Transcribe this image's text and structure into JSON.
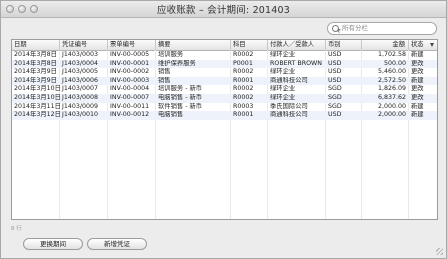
{
  "window": {
    "title": "应收账款 – 会计期间: 201403"
  },
  "search": {
    "placeholder": "所有分栏"
  },
  "table": {
    "columns": [
      "日期",
      "凭证编号",
      "票单编号",
      "摘要",
      "科目",
      "付款人／受款人",
      "币别",
      "金额",
      "状态"
    ],
    "rows": [
      [
        "2014年3月8日",
        "J1403/0003",
        "INV-00-0005",
        "培训服务",
        "R0002",
        "绿环企业",
        "USD",
        "1,702.58",
        "新建"
      ],
      [
        "2014年3月8日",
        "J1403/0004",
        "INV-00-0001",
        "维护保养服务",
        "P0001",
        "ROBERT BROWN",
        "USD",
        "500.00",
        "更改"
      ],
      [
        "2014年3月9日",
        "J1403/0005",
        "INV-00-0002",
        "销售",
        "R0002",
        "绿环企业",
        "USD",
        "5,460.00",
        "更改"
      ],
      [
        "2014年3月9日",
        "J1403/0006",
        "INV-00-0003",
        "销售",
        "R0001",
        "商通科技公司",
        "USD",
        "2,572.50",
        "新建"
      ],
      [
        "2014年3月10日",
        "J1403/0007",
        "INV-00-0004",
        "培训服务 - 新币",
        "R0002",
        "绿环企业",
        "SGD",
        "1,826.09",
        "更改"
      ],
      [
        "2014年3月10日",
        "J1403/0008",
        "INV-00-0007",
        "电脑销售 - 新币",
        "R0002",
        "绿环企业",
        "SGD",
        "6,837.62",
        "更改"
      ],
      [
        "2014年3月11日",
        "J1403/0009",
        "INV-00-0011",
        "软件销售 - 新币",
        "R0003",
        "季氏国际公司",
        "SGD",
        "2,000.00",
        "新建"
      ],
      [
        "2014年3月12日",
        "J1403/0010",
        "INV-00-0012",
        "电脑销售",
        "R0001",
        "商通科技公司",
        "USD",
        "2,000.00",
        "新建"
      ]
    ]
  },
  "footer": {
    "count_text": "8 行",
    "buttons": {
      "change_period": "更换期间",
      "new_voucher": "新增凭证"
    }
  }
}
